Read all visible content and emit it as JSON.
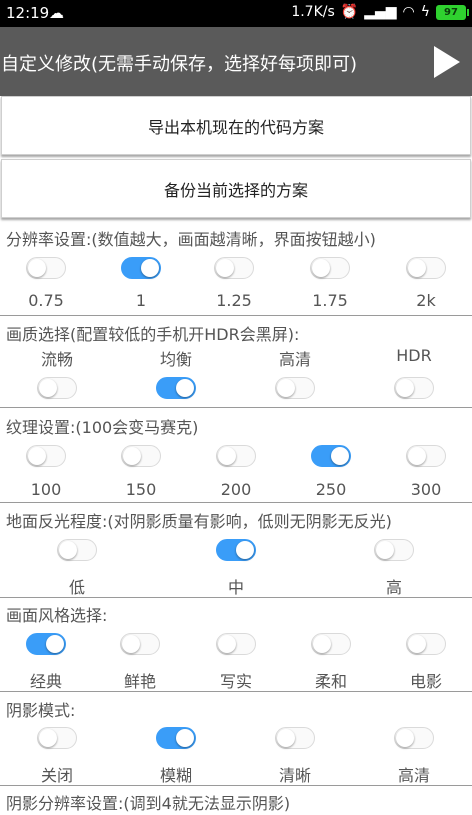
{
  "status": {
    "time": "12:19",
    "speed": "1.7K/s",
    "battery": "97"
  },
  "header": {
    "title": "自定义修改(无需手动保存，选择好每项即可)"
  },
  "buttons": {
    "export_label": "导出本机现在的代码方案",
    "backup_label": "备份当前选择的方案"
  },
  "sections": {
    "resolution": {
      "title": "分辨率设置:(数值越大，画面越清晰，界面按钮越小)",
      "options": [
        "0.75",
        "1",
        "1.25",
        "1.75",
        "2k"
      ],
      "selected_index": 1
    },
    "quality": {
      "title": "画质选择(配置较低的手机开HDR会黑屏):",
      "options": [
        "流畅",
        "均衡",
        "高清",
        "HDR"
      ],
      "selected_index": 1
    },
    "texture": {
      "title": "纹理设置:(100会变马赛克)",
      "options": [
        "100",
        "150",
        "200",
        "250",
        "300"
      ],
      "selected_index": 3
    },
    "reflection": {
      "title": "地面反光程度:(对阴影质量有影响，低则无阴影无反光)",
      "options": [
        "低",
        "中",
        "高"
      ],
      "selected_index": 1
    },
    "style": {
      "title": "画面风格选择:",
      "options": [
        "经典",
        "鲜艳",
        "写实",
        "柔和",
        "电影"
      ],
      "selected_index": 0
    },
    "shadow": {
      "title": "阴影模式:",
      "options": [
        "关闭",
        "模糊",
        "清晰",
        "高清"
      ],
      "selected_index": 1
    },
    "shadow_res": {
      "title": "阴影分辨率设置:(调到4就无法显示阴影)"
    }
  },
  "colors": {
    "accent": "#3a9df8",
    "titlebar": "#5a5a5a"
  }
}
